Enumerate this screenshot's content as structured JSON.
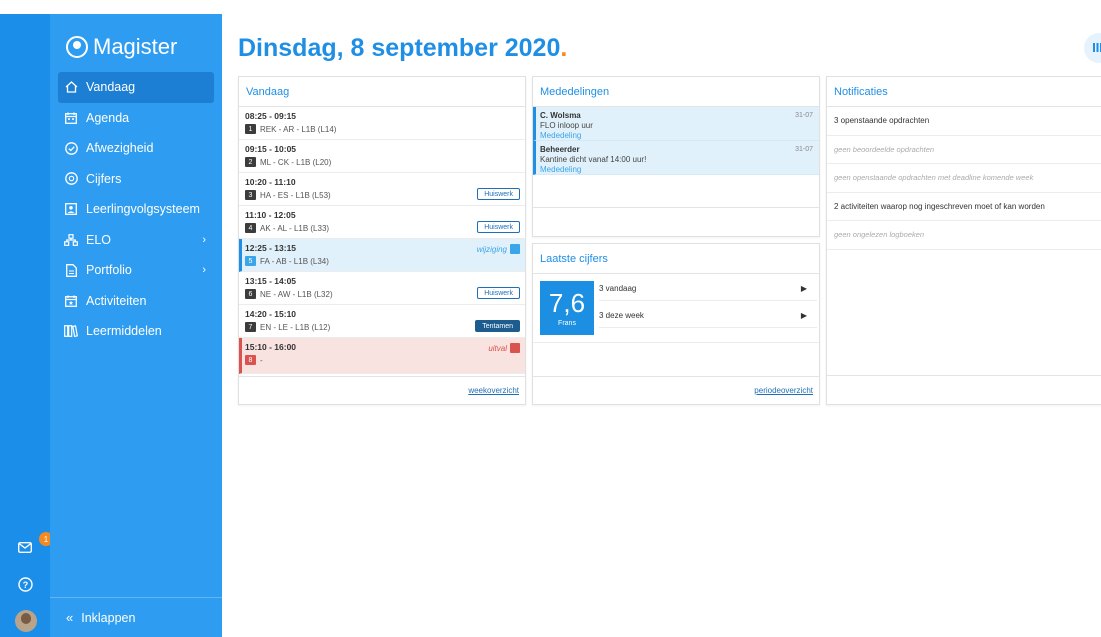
{
  "app": {
    "name": "Magister"
  },
  "colors": {
    "primary": "#1f8fe5",
    "sidebar": "#2e9cf0",
    "rail": "#1a8ee8",
    "accent": "#f48a1f",
    "cancel": "#d9534f"
  },
  "rail": {
    "mail_badge": "1",
    "icons": [
      "mail-icon",
      "help-icon",
      "avatar"
    ]
  },
  "sidebar": {
    "items": [
      {
        "label": "Vandaag",
        "icon": "home-icon",
        "active": true
      },
      {
        "label": "Agenda",
        "icon": "calendar-icon"
      },
      {
        "label": "Afwezigheid",
        "icon": "check-circle-icon"
      },
      {
        "label": "Cijfers",
        "icon": "grades-icon"
      },
      {
        "label": "Leerlingvolgsysteem",
        "icon": "person-card-icon"
      },
      {
        "label": "ELO",
        "icon": "sitemap-icon",
        "has_submenu": true
      },
      {
        "label": "Portfolio",
        "icon": "document-icon",
        "has_submenu": true
      },
      {
        "label": "Activiteiten",
        "icon": "calendar-star-icon"
      },
      {
        "label": "Leermiddelen",
        "icon": "books-icon"
      }
    ],
    "collapse_label": "Inklappen"
  },
  "header": {
    "title": "Dinsdag, 8 september 2020",
    "title_dot": "."
  },
  "today": {
    "title": "Vandaag",
    "rows": [
      {
        "time": "08:25 - 09:15",
        "hour": "1",
        "info": "REK - AR - L1B (L14)"
      },
      {
        "time": "09:15 - 10:05",
        "hour": "2",
        "info": "ML - CK - L1B (L20)"
      },
      {
        "time": "10:20 - 11:10",
        "hour": "3",
        "info": "HA - ES - L1B (L53)",
        "tag": "Huiswerk"
      },
      {
        "time": "11:10 - 12:05",
        "hour": "4",
        "info": "AK - AL - L1B (L33)",
        "tag": "Huiswerk"
      },
      {
        "time": "12:25 - 13:15",
        "hour": "5",
        "info": "FA - AB - L1B (L34)",
        "status": "wijziging",
        "state": "changed"
      },
      {
        "time": "13:15 - 14:05",
        "hour": "6",
        "info": "NE - AW - L1B (L32)",
        "tag": "Huiswerk"
      },
      {
        "time": "14:20 - 15:10",
        "hour": "7",
        "info": "EN - LE - L1B (L12)",
        "tag": "Tentamen",
        "tag_dark": true
      },
      {
        "time": "15:10 - 16:00",
        "hour": "8",
        "info": "-",
        "status": "uitval",
        "state": "cancel"
      }
    ],
    "footer": "weekoverzicht"
  },
  "announcements": {
    "title": "Mededelingen",
    "items": [
      {
        "name": "C. Wolsma",
        "text": "FLO inloop uur",
        "type": "Mededeling",
        "date": "31-07"
      },
      {
        "name": "Beheerder",
        "text": "Kantine dicht vanaf 14:00 uur!",
        "type": "Mededeling",
        "date": "31-07"
      }
    ]
  },
  "grades": {
    "title": "Laatste cijfers",
    "latest_grade": "7,6",
    "latest_subject": "Frans",
    "rows": [
      {
        "label": "3 vandaag"
      },
      {
        "label": "3 deze week"
      }
    ],
    "footer": "periodeoverzicht"
  },
  "notifications": {
    "title": "Notificaties",
    "items": [
      {
        "text": "3 openstaande opdrachten",
        "muted": false
      },
      {
        "text": "geen beoordeelde opdrachten",
        "muted": true
      },
      {
        "text": "geen openstaande opdrachten met deadline komende week",
        "muted": true
      },
      {
        "text": "2 activiteiten waarop nog ingeschreven moet of kan worden",
        "muted": false
      },
      {
        "text": "geen ongelezen logboeken",
        "muted": true
      }
    ]
  }
}
